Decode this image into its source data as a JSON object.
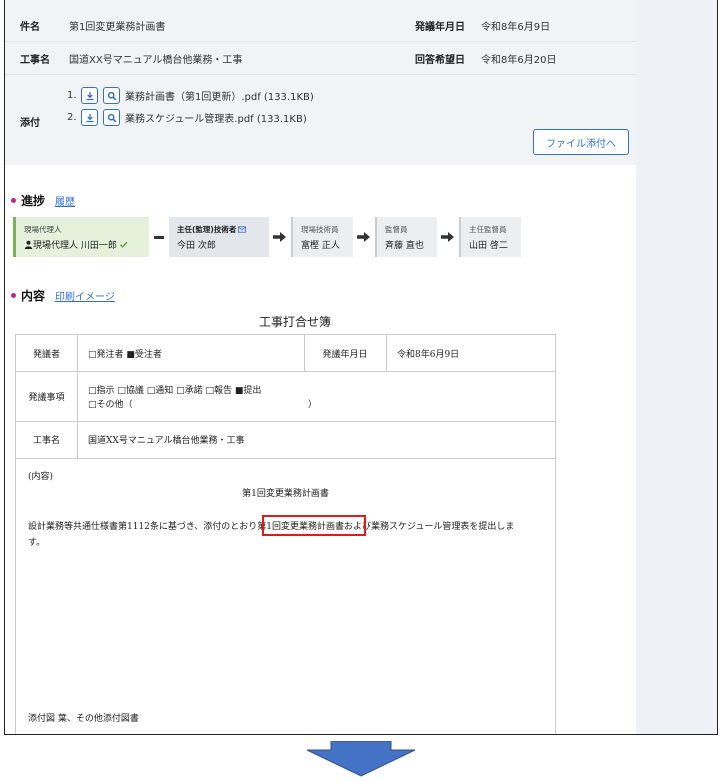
{
  "header": {
    "subject_label": "件名",
    "subject_value": "第1回変更業務計画書",
    "issue_date_label": "発議年月日",
    "issue_date_value": "令和8年6月9日",
    "work_label": "工事名",
    "work_value": "国道XX号マニュアル橋台他業務・工事",
    "reply_date_label": "回答希望日",
    "reply_date_value": "令和8年6月20日",
    "attach_label": "添付",
    "attachments": [
      {
        "num": "1.",
        "name": "業務計画書（第1回更新）.pdf (133.1KB)"
      },
      {
        "num": "2.",
        "name": "業務スケジュール管理表.pdf (133.1KB)"
      }
    ],
    "file_attach_button": "ファイル添付へ"
  },
  "progress": {
    "title": "進捗",
    "history_link": "履歴",
    "steps": [
      {
        "role": "現場代理人",
        "name": "現場代理人 川田一郎"
      },
      {
        "role": "主任(監理)技術者",
        "name": "今田 次郎"
      },
      {
        "role": "現場技術員",
        "name": "富樫 正人"
      },
      {
        "role": "監督員",
        "name": "斉藤 直也"
      },
      {
        "role": "主任監督員",
        "name": "山田 啓二"
      }
    ]
  },
  "content": {
    "title": "内容",
    "print_link": "印刷イメージ"
  },
  "document": {
    "title": "工事打合せ簿",
    "issuer_label": "発議者",
    "issuer_value": "□発注者 ■受注者",
    "issue_date_label": "発議年月日",
    "issue_date_value": "令和8年6月9日",
    "matter_label": "発議事項",
    "matter_line1": "□指示 □協議 □通知 □承諾 □報告 ■提出",
    "matter_line2": "□その他（",
    "matter_close": "）",
    "work_label": "工事名",
    "work_value": "国道XX号マニュアル橋台他業務・工事",
    "body_label": "(内容)",
    "body_title": "第1回変更業務計画書",
    "body_line1": "設計業務等共通仕様書第1112条に基づき、添付のとおり第1回変更業務計画書および業務スケジュール管理表を提出しま",
    "body_line2": "す。",
    "footer": "添付図 葉、その他添付図書"
  },
  "colors": {
    "accent": "#2f6fd6",
    "bullet": "#c0268a",
    "highlight": "#e01b1b",
    "arrow": "#4472c4"
  }
}
